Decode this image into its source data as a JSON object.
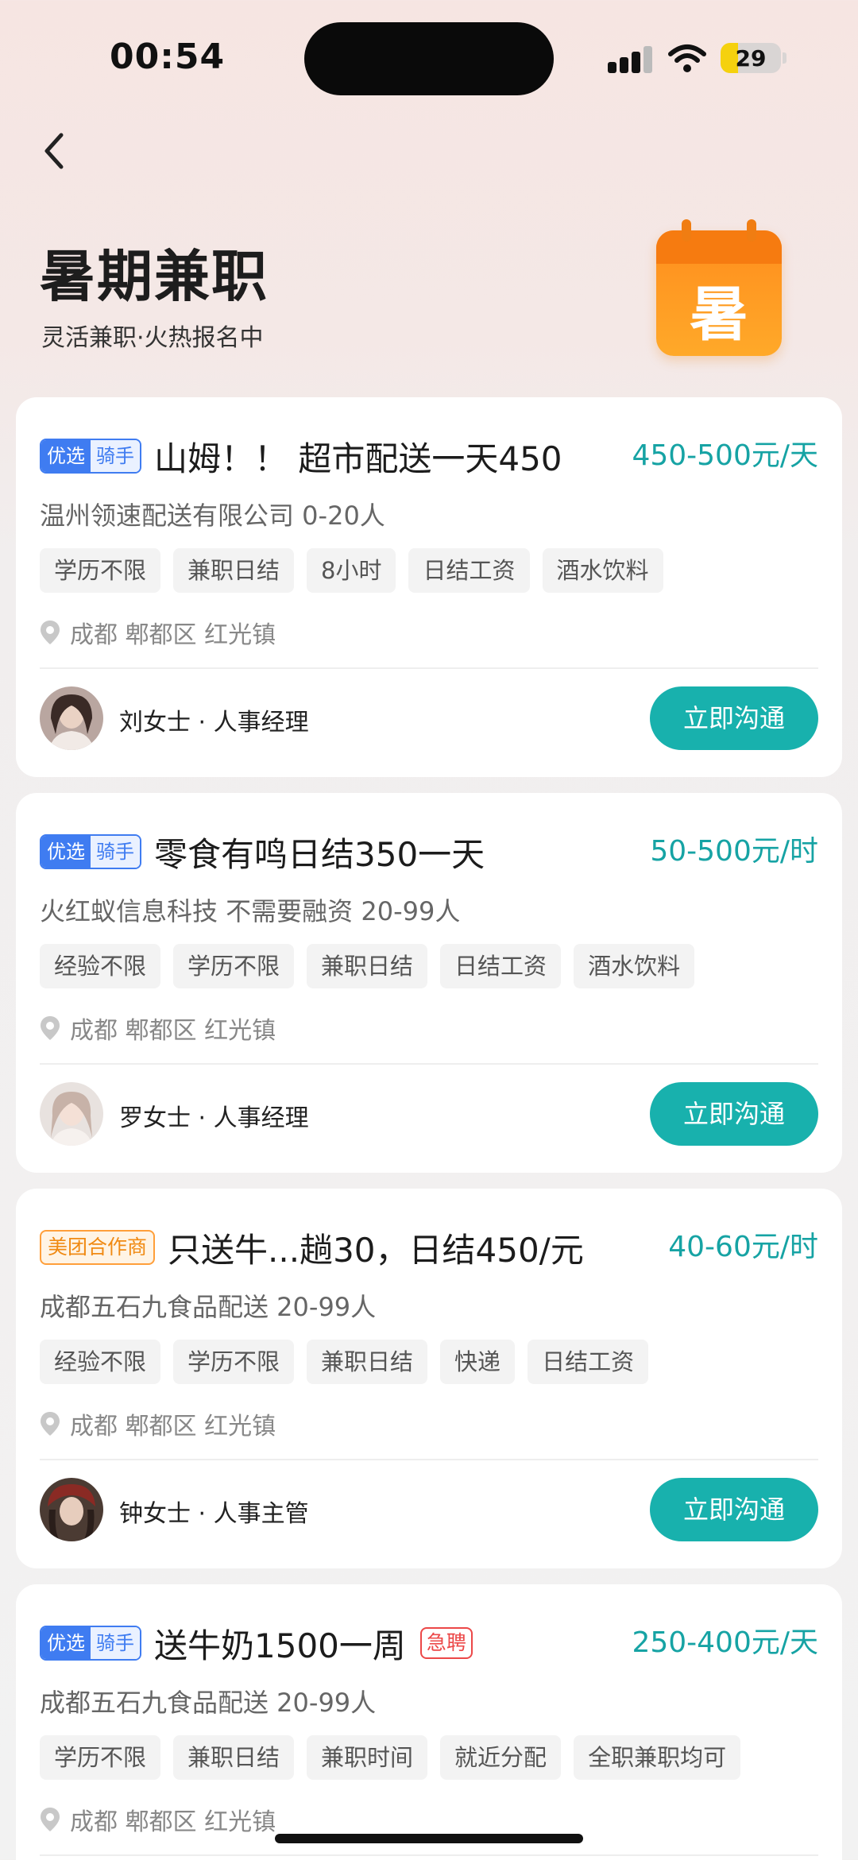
{
  "status_bar": {
    "time": "00:54",
    "battery": "29",
    "battery_level": 0.29
  },
  "header": {
    "title": "暑期兼职",
    "subtitle": "灵活兼职·火热报名中",
    "banner_char": "暑",
    "banner_color": "#ff8d1d"
  },
  "jobs": [
    {
      "badge": {
        "primary": "优选",
        "secondary": "骑手"
      },
      "title": "山姆！！ 超市配送一天450",
      "salary": "450-500元/天",
      "company": "温州领速配送有限公司 0-20人",
      "tags": [
        "学历不限",
        "兼职日结",
        "8小时",
        "日结工资",
        "酒水饮料"
      ],
      "location": "成都 郫都区 红光镇",
      "contact": "刘女士 · 人事经理",
      "action": "立即沟通"
    },
    {
      "badge": {
        "primary": "优选",
        "secondary": "骑手"
      },
      "title": "零食有鸣日结350一天",
      "salary": "50-500元/时",
      "company": "火红蚁信息科技 不需要融资 20-99人",
      "tags": [
        "经验不限",
        "学历不限",
        "兼职日结",
        "日结工资",
        "酒水饮料"
      ],
      "location": "成都 郫都区 红光镇",
      "contact": "罗女士 · 人事经理",
      "action": "立即沟通"
    },
    {
      "badge": {
        "partner": "美团合作商"
      },
      "title": "只送牛...趟30，日结450/元",
      "salary": "40-60元/时",
      "company": "成都五石九食品配送 20-99人",
      "tags": [
        "经验不限",
        "学历不限",
        "兼职日结",
        "快递",
        "日结工资"
      ],
      "location": "成都 郫都区 红光镇",
      "contact": "钟女士 · 人事主管",
      "action": "立即沟通"
    },
    {
      "badge": {
        "primary": "优选",
        "secondary": "骑手"
      },
      "title": "送牛奶1500一周",
      "urgent": "急聘",
      "salary": "250-400元/天",
      "company": "成都五石九食品配送 20-99人",
      "tags": [
        "学历不限",
        "兼职日结",
        "兼职时间",
        "就近分配",
        "全职兼职均可"
      ],
      "location": "成都 郫都区 红光镇"
    }
  ],
  "colors": {
    "accent": "#18b1ad",
    "salary": "#16a3a4",
    "badge_blue": "#3f7cf1",
    "partner_orange": "#f08a13",
    "urgent_red": "#ec4848"
  }
}
